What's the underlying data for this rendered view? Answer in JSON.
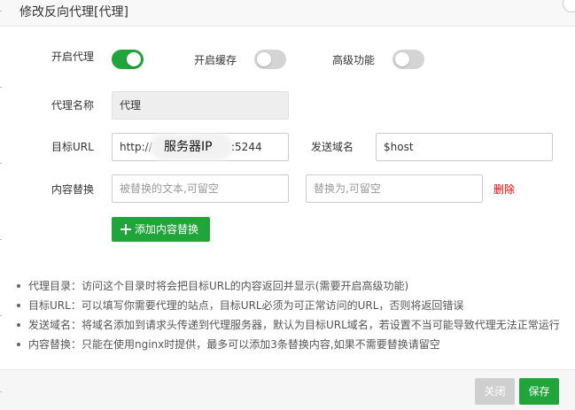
{
  "dialog": {
    "title": "修改反向代理[代理]"
  },
  "switches": {
    "proxy": {
      "label": "开启代理",
      "enabled": true
    },
    "cache": {
      "label": "开启缓存",
      "enabled": false
    },
    "advanced": {
      "label": "高级功能",
      "enabled": false
    }
  },
  "form": {
    "name_label": "代理名称",
    "name_value": "代理",
    "target_url_label": "目标URL",
    "target_url_prefix": "http://",
    "target_url_overlay": "服务器IP",
    "target_url_port": ":5244",
    "send_domain_label": "发送域名",
    "send_domain_value": "$host",
    "replace_label": "内容替换",
    "replace_from_placeholder": "被替换的文本,可留空",
    "replace_to_placeholder": "替换为,可留空",
    "delete_label": "删除",
    "add_replace_label": "添加内容替换"
  },
  "tips": [
    "代理目录：访问这个目录时将会把目标URL的内容返回并显示(需要开启高级功能)",
    "目标URL：可以填写你需要代理的站点，目标URL必须为可正常访问的URL，否则将返回错误",
    "发送域名：将域名添加到请求头传递到代理服务器，默认为目标URL域名，若设置不当可能导致代理无法正常运行",
    "内容替换：只能在使用nginx时提供，最多可以添加3条替换内容,如果不需要替换请留空"
  ],
  "footer": {
    "close_label": "关闭",
    "save_label": "保存"
  },
  "colors": {
    "accent": "#20a53a",
    "danger": "#e50000",
    "toggle_off": "#d4d4d4"
  }
}
